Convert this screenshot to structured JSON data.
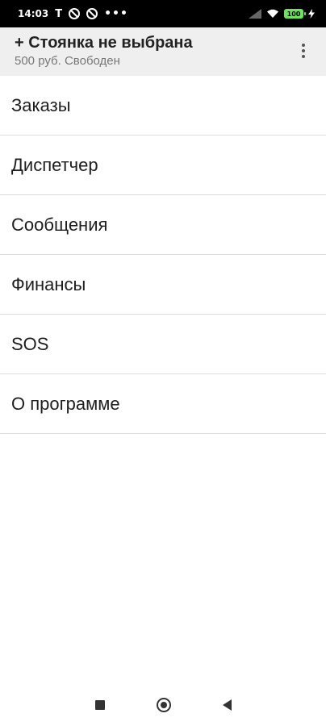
{
  "status_bar": {
    "time": "14:03",
    "carrier_glyph": "T",
    "overflow_dots": "•••",
    "battery_level": "100",
    "battery_color": "#6be45d",
    "icons": [
      "no-entry-icon",
      "no-entry-icon",
      "signal-icon",
      "wifi-icon",
      "battery-icon",
      "charging-icon"
    ]
  },
  "app_bar": {
    "title": "+ Стоянка не выбрана",
    "subtitle": "500 руб. Свободен",
    "menu_icon": "more-vert-icon"
  },
  "menu": {
    "items": [
      {
        "label": "Заказы"
      },
      {
        "label": "Диспетчер"
      },
      {
        "label": "Сообщения"
      },
      {
        "label": "Финансы"
      },
      {
        "label": "SOS"
      },
      {
        "label": "О программе"
      }
    ]
  },
  "nav_bar": {
    "icons": [
      "recents-icon",
      "home-icon",
      "back-icon"
    ]
  }
}
